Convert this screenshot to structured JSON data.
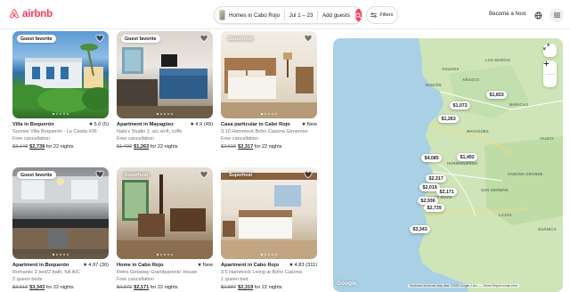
{
  "header": {
    "brand": "airbnb",
    "search": {
      "location": "Homes in Cabo Rojo",
      "dates": "Jul 1 – 23",
      "guests": "Add guests"
    },
    "filters_label": "Filters",
    "become_host": "Become a host"
  },
  "listings": [
    {
      "badge": "Guest favorite",
      "title": "Villa in Boquerón",
      "rating": "5.0 (5)",
      "description": "Sunrise Villa Boquerón - La Casita #36",
      "sub": "Free cancellation",
      "price_old": "$3,148",
      "price_new": "$2,739",
      "nights": "for 22 nights"
    },
    {
      "badge": "Guest favorite",
      "title": "Apartment in Mayagüez",
      "rating": "4.9 (49)",
      "description": "Nala's Studio 1, a/c wi-fi, coffe",
      "sub": "Free cancellation",
      "price_old": "$1,499",
      "price_new": "$1,263",
      "nights": "for 22 nights"
    },
    {
      "badge": "Superhost",
      "title": "Casa particular in Cabo Rojo",
      "rating": "New",
      "description": "3.10 Hammock Boho Casona Generoso",
      "sub": "Free cancellation",
      "price_old": "$2,615",
      "price_new": "$2,317",
      "nights": "for 22 nights"
    },
    {
      "badge": "Guest favorite",
      "title": "Apartment in Boquerón",
      "rating": "4.97 (30)",
      "description": "Romantic 2 bed/2 bath, full A/C",
      "sub": "2 queen beds",
      "price_old": "$3,613",
      "price_new": "$3,343",
      "nights": "for 22 nights"
    },
    {
      "badge": "Superhost",
      "title": "Home in Cabo Rojo",
      "rating": "New",
      "description": "Retro Getaway Grandparents' House",
      "sub": "Free cancellation",
      "price_old": "$2,373",
      "price_new": "$2,171",
      "nights": "for 22 nights"
    },
    {
      "badge": "Superhost",
      "title": "Apartment in Cabo Rojo",
      "rating": "4.83 (311)",
      "description": "3.5 Hammock Living at Boho Casona",
      "sub": "1 queen bed",
      "price_old": "$2,587",
      "price_new": "$2,319",
      "nights": "for 22 nights"
    }
  ],
  "map": {
    "pins": [
      "$1,833",
      "$1,072",
      "$1,263",
      "$1,492",
      "$4,085",
      "$2,317",
      "$2,019",
      "$2,171",
      "$2,936",
      "$2,739",
      "$3,343"
    ],
    "labels": {
      "anasco": "AÑASCO",
      "rincon": "RINCÓN",
      "aguada": "AGUADA",
      "mayaguez": "MAYAGÜEZ",
      "maricao": "MARICAO",
      "sabana_grande": "SABANA GRANDE",
      "san_german": "SAN GERMÁN",
      "hormigueros": "HORMIGUEROS",
      "cabo_rojo": "CABO ROJO",
      "lajas": "LAJAS",
      "guanica": "GUÁNICA",
      "las_marias": "LAS MARÍAS",
      "yauco": "YAUCO"
    },
    "google": "Google",
    "attribution": "Keyboard shortcuts   Map data ©2025 Google   2 km ⎯⎯⎯   Terms   Report a map error"
  },
  "colors": {
    "brand": "#FF385C",
    "water": "#a9d0e4",
    "land": "#cfe5b8"
  }
}
